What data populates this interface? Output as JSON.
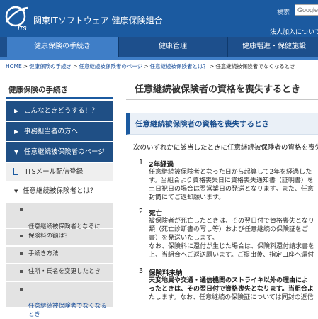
{
  "header": {
    "site_title": "関東ITソフトウェア 健康保険組合",
    "logo_text": "ITS",
    "search_label": "検索",
    "search_placeholder": "Google",
    "join_link": "法人加入について"
  },
  "nav": {
    "items": [
      {
        "label": "健康保険の手続き",
        "active": true
      },
      {
        "label": "健康管理",
        "active": false
      },
      {
        "label": "健康増進・保健施設",
        "active": false
      }
    ]
  },
  "breadcrumb": {
    "items": [
      "HOME",
      "健康保険の手続き",
      "任意継続被保険者のページ",
      "任意継続被保険者とは？",
      "任意継続被保険者でなくなるとき"
    ]
  },
  "sidebar": {
    "title": "健康保険の手続き",
    "items": [
      {
        "label": "こんなときどうする！？"
      },
      {
        "label": "事務担当者の方へ"
      },
      {
        "label": "任意継続被保険者のページ"
      }
    ],
    "mail": "ITSメール配信登録",
    "group": "任意継続被保険者とは？",
    "subitems": [
      {
        "label": "任意継続被保険者となるに\nは？"
      },
      {
        "label": "保険料の額は？"
      },
      {
        "label": "手続き方法"
      },
      {
        "label": "住所・氏名を変更したとき"
      },
      {
        "label": "任意継続被保険者でなくなる\nとき"
      }
    ]
  },
  "main": {
    "title": "任意継続被保険者の資格を喪失するとき",
    "section_title": "任意継続被保険者の資格を喪失するとき",
    "intro": "次のいずれかに該当したときに任意継続被保険者の資格を喪失",
    "items": [
      {
        "num": "1.",
        "head": "2年経過",
        "body": "任意継続被保険者となった日から起算して2年を経過した\nす。当組合より資格喪失日に資格喪失通知書（証明書）を\n土日祝日の場合は翌営業日の発送となります。また、任意\n封筒にてご返却願います。"
      },
      {
        "num": "2.",
        "head": "死亡",
        "body": "被保険者が死亡したときは、その翌日付で資格喪失となり\n類（死亡診断書の写し等）および任意継続の保険証をご\n書）を発送いたします。\nなお、保険料に還付が生じた場合は、保険料還付請求書を\n上、当組合へご返送願います。ご提出後、指定口座へ還付"
      },
      {
        "num": "3.",
        "head": "保険料未納",
        "sub": "天変地異や交通・通信機関のストライキ以外の理由によ\nったときは、その翌日付で資格喪失となります。当組合よ",
        "body": "たします。なお、任意継続の保険証については同封の返信"
      }
    ]
  }
}
